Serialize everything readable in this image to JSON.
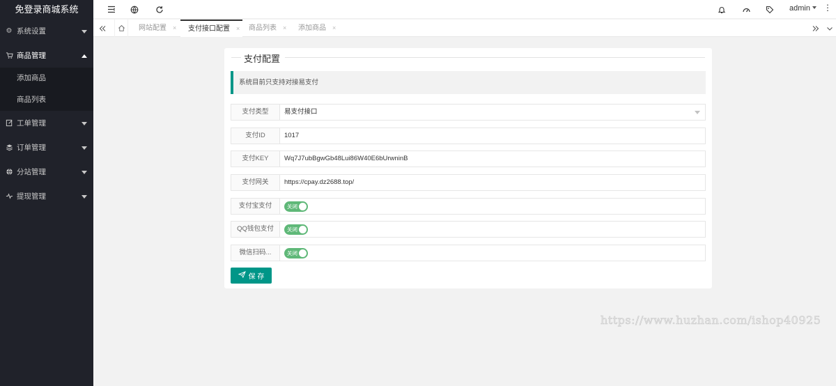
{
  "app": {
    "title": "免登录商城系统"
  },
  "sidebar": {
    "items": [
      {
        "label": "系统设置",
        "icon": "gear-icon",
        "expanded": false
      },
      {
        "label": "商品管理",
        "icon": "cart-icon",
        "expanded": true,
        "children": [
          "添加商品",
          "商品列表"
        ]
      },
      {
        "label": "工单管理",
        "icon": "edit-icon",
        "expanded": false
      },
      {
        "label": "订单管理",
        "icon": "stack-icon",
        "expanded": false
      },
      {
        "label": "分站管理",
        "icon": "globe-icon",
        "expanded": false
      },
      {
        "label": "提现管理",
        "icon": "pulse-icon",
        "expanded": false
      }
    ]
  },
  "header": {
    "icons": [
      "menu-fold-icon",
      "globe-icon",
      "refresh-icon",
      "bell-icon",
      "theme-icon",
      "tag-icon",
      "more-icon"
    ],
    "user": "admin"
  },
  "tabs": [
    {
      "label": "网站配置",
      "active": false
    },
    {
      "label": "支付接口配置",
      "active": true
    },
    {
      "label": "商品列表",
      "active": false
    },
    {
      "label": "添加商品",
      "active": false
    }
  ],
  "form": {
    "legend": "支付配置",
    "notice": "系统目前只支持对接易支付",
    "fields": [
      {
        "label": "支付类型",
        "value": "易支付接口",
        "type": "select"
      },
      {
        "label": "支付ID",
        "value": "1017",
        "type": "input"
      },
      {
        "label": "支付KEY",
        "value": "Wq7J7ubBgwGb48Lui86W40E6bUrwninB",
        "type": "input"
      },
      {
        "label": "支付网关",
        "value": "https://cpay.dz2688.top/",
        "type": "input"
      },
      {
        "label": "支付宝支付",
        "switch_text": "关闭",
        "type": "switch"
      },
      {
        "label": "QQ钱包支付",
        "switch_text": "关闭",
        "type": "switch"
      },
      {
        "label": "微信扫码...",
        "switch_text": "关闭",
        "type": "switch"
      }
    ],
    "save_label": "保 存"
  },
  "watermark": "https://www.huzhan.com/ishop40925",
  "colors": {
    "sidebar_bg": "#20222a",
    "accent": "#009688",
    "switch_on": "#5fb878"
  }
}
